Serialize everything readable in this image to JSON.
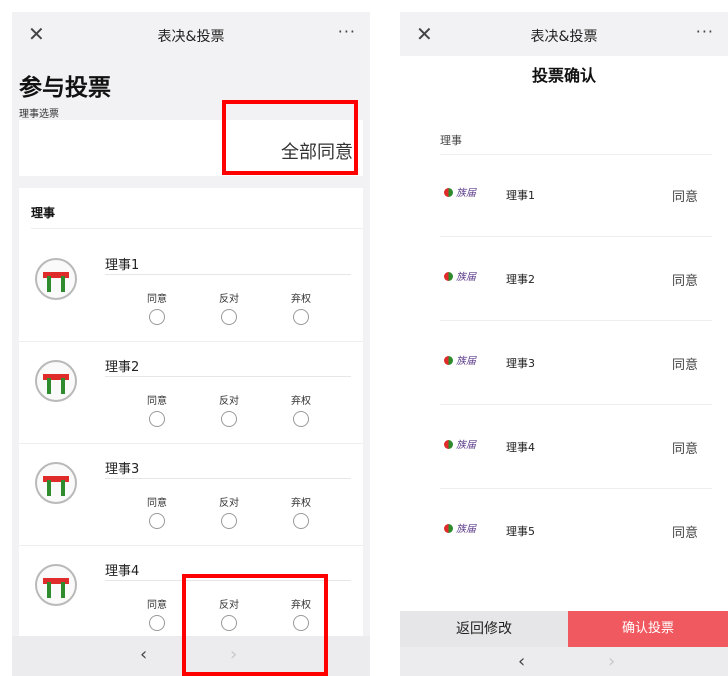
{
  "left": {
    "topbar": {
      "close_icon": "close-icon",
      "title": "表决&投票",
      "more": "···"
    },
    "page_title": "参与投票",
    "section_label": "理事选票",
    "agree_all_label": "全部同意",
    "group_title": "理事",
    "option_labels": [
      "同意",
      "反对",
      "弃权"
    ],
    "members": [
      {
        "name": "理事1"
      },
      {
        "name": "理事2"
      },
      {
        "name": "理事3"
      },
      {
        "name": "理事4"
      }
    ],
    "nav": {
      "back": "‹",
      "forward": "›"
    }
  },
  "right": {
    "topbar": {
      "close_icon": "close-icon",
      "title": "表决&投票",
      "more": "···"
    },
    "confirm_title": "投票确认",
    "group_title": "理事",
    "logo_text": "族届",
    "rows": [
      {
        "name": "理事1",
        "vote": "同意"
      },
      {
        "name": "理事2",
        "vote": "同意"
      },
      {
        "name": "理事3",
        "vote": "同意"
      },
      {
        "name": "理事4",
        "vote": "同意"
      },
      {
        "name": "理事5",
        "vote": "同意"
      }
    ],
    "back_button": "返回修改",
    "confirm_button": "确认投票",
    "nav": {
      "back": "‹",
      "forward": "›"
    }
  },
  "colors": {
    "highlight": "#ff0000",
    "confirm": "#f0595f",
    "avatar_red": "#e02b2b",
    "avatar_green": "#2e8b2e"
  }
}
